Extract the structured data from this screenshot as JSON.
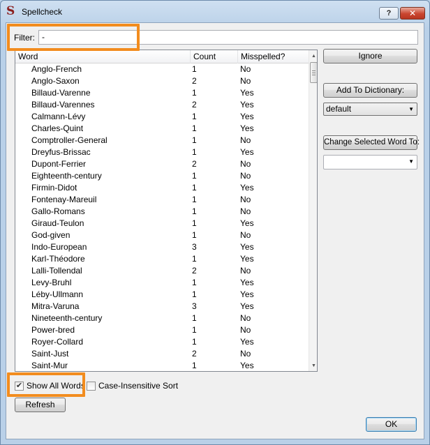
{
  "window": {
    "title": "Spellcheck",
    "help_label": "?",
    "close_label": "✕",
    "icon_glyph": "S"
  },
  "filter": {
    "label": "Filter:",
    "value": "-"
  },
  "table": {
    "columns": [
      "Word",
      "Count",
      "Misspelled?"
    ],
    "rows": [
      {
        "word": "Anglo-French",
        "count": "1",
        "misspelled": "No"
      },
      {
        "word": "Anglo-Saxon",
        "count": "2",
        "misspelled": "No"
      },
      {
        "word": "Billaud-Varenne",
        "count": "1",
        "misspelled": "Yes"
      },
      {
        "word": "Billaud-Varennes",
        "count": "2",
        "misspelled": "Yes"
      },
      {
        "word": "Calmann-Lévy",
        "count": "1",
        "misspelled": "Yes"
      },
      {
        "word": "Charles-Quint",
        "count": "1",
        "misspelled": "Yes"
      },
      {
        "word": "Comptroller-General",
        "count": "1",
        "misspelled": "No"
      },
      {
        "word": "Dreyfus-Brissac",
        "count": "1",
        "misspelled": "Yes"
      },
      {
        "word": "Dupont-Ferrier",
        "count": "2",
        "misspelled": "No"
      },
      {
        "word": "Eighteenth-century",
        "count": "1",
        "misspelled": "No"
      },
      {
        "word": "Firmin-Didot",
        "count": "1",
        "misspelled": "Yes"
      },
      {
        "word": "Fontenay-Mareuil",
        "count": "1",
        "misspelled": "No"
      },
      {
        "word": "Gallo-Romans",
        "count": "1",
        "misspelled": "No"
      },
      {
        "word": "Giraud-Teulon",
        "count": "1",
        "misspelled": "Yes"
      },
      {
        "word": "God-given",
        "count": "1",
        "misspelled": "No"
      },
      {
        "word": "Indo-European",
        "count": "3",
        "misspelled": "Yes"
      },
      {
        "word": "Karl-Théodore",
        "count": "1",
        "misspelled": "Yes"
      },
      {
        "word": "Lalli-Tollendal",
        "count": "2",
        "misspelled": "No"
      },
      {
        "word": "Levy-Bruhl",
        "count": "1",
        "misspelled": "Yes"
      },
      {
        "word": "Léby-Ullmann",
        "count": "1",
        "misspelled": "Yes"
      },
      {
        "word": "Mitra-Varuna",
        "count": "3",
        "misspelled": "Yes"
      },
      {
        "word": "Nineteenth-century",
        "count": "1",
        "misspelled": "No"
      },
      {
        "word": "Power-bred",
        "count": "1",
        "misspelled": "No"
      },
      {
        "word": "Royer-Collard",
        "count": "1",
        "misspelled": "Yes"
      },
      {
        "word": "Saint-Just",
        "count": "2",
        "misspelled": "No"
      },
      {
        "word": "Saint-Mur",
        "count": "1",
        "misspelled": "Yes"
      }
    ]
  },
  "actions": {
    "ignore_label": "Ignore",
    "add_label": "Add To Dictionary:",
    "dictionary_selected": "default",
    "change_label": "Change Selected Word To:",
    "change_value": ""
  },
  "options": {
    "show_all_label": "Show All Words",
    "show_all_checked": true,
    "case_label": "Case-Insensitive Sort",
    "case_checked": false,
    "checkmark_glyph": "✔"
  },
  "footer": {
    "refresh_label": "Refresh",
    "ok_label": "OK"
  },
  "colors": {
    "highlight": "#f28c1e"
  }
}
